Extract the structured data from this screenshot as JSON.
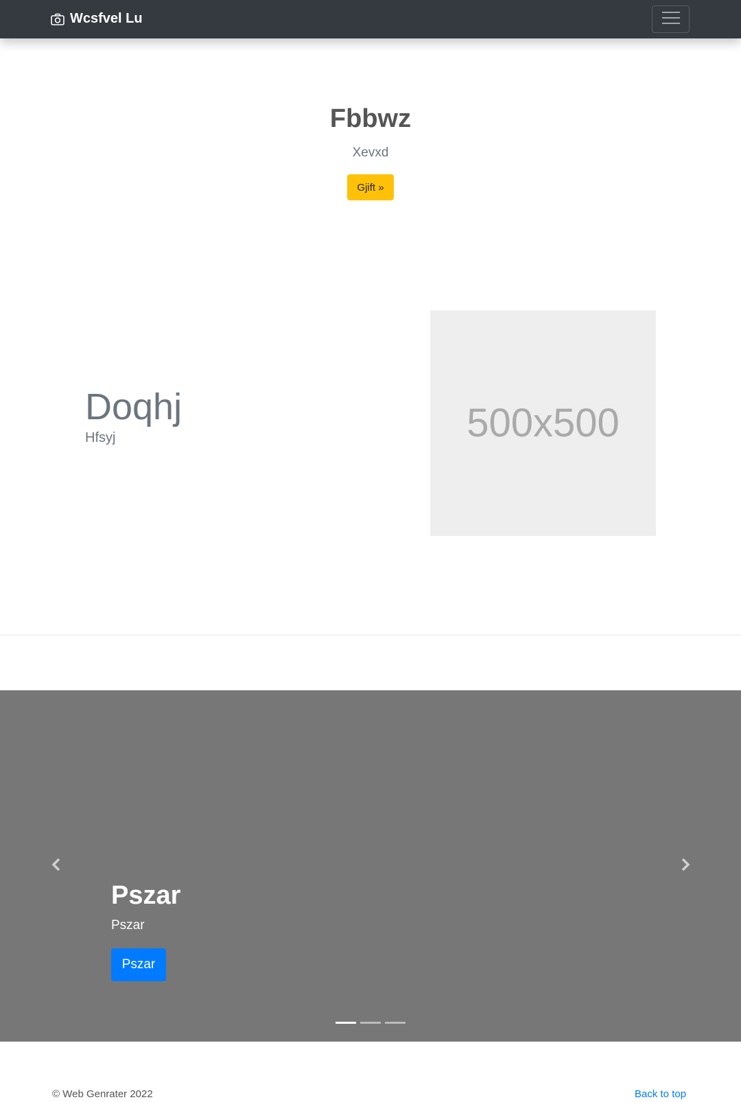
{
  "navbar": {
    "brand": "Wcsfvel Lu",
    "brand_icon": "camera-icon",
    "menu_icon": "hamburger-menu-icon"
  },
  "hero": {
    "title": "Fbbwz",
    "subtitle": "Xevxd",
    "button_label": "Gjift »",
    "button_color": "#ffc107"
  },
  "feature": {
    "heading": "Doqhj",
    "subheading": "Hfsyj",
    "image_text": "500x500"
  },
  "carousel": {
    "caption_title": "Pszar",
    "caption_text": "Pszar",
    "button_label": "Pszar",
    "button_color": "#007bff",
    "active_slide": 1,
    "slide_count": 3,
    "prev_icon": "chevron-left-icon",
    "next_icon": "chevron-right-icon"
  },
  "footer": {
    "copyright": "© Web Genrater 2022",
    "back_to_top": "Back to top"
  }
}
